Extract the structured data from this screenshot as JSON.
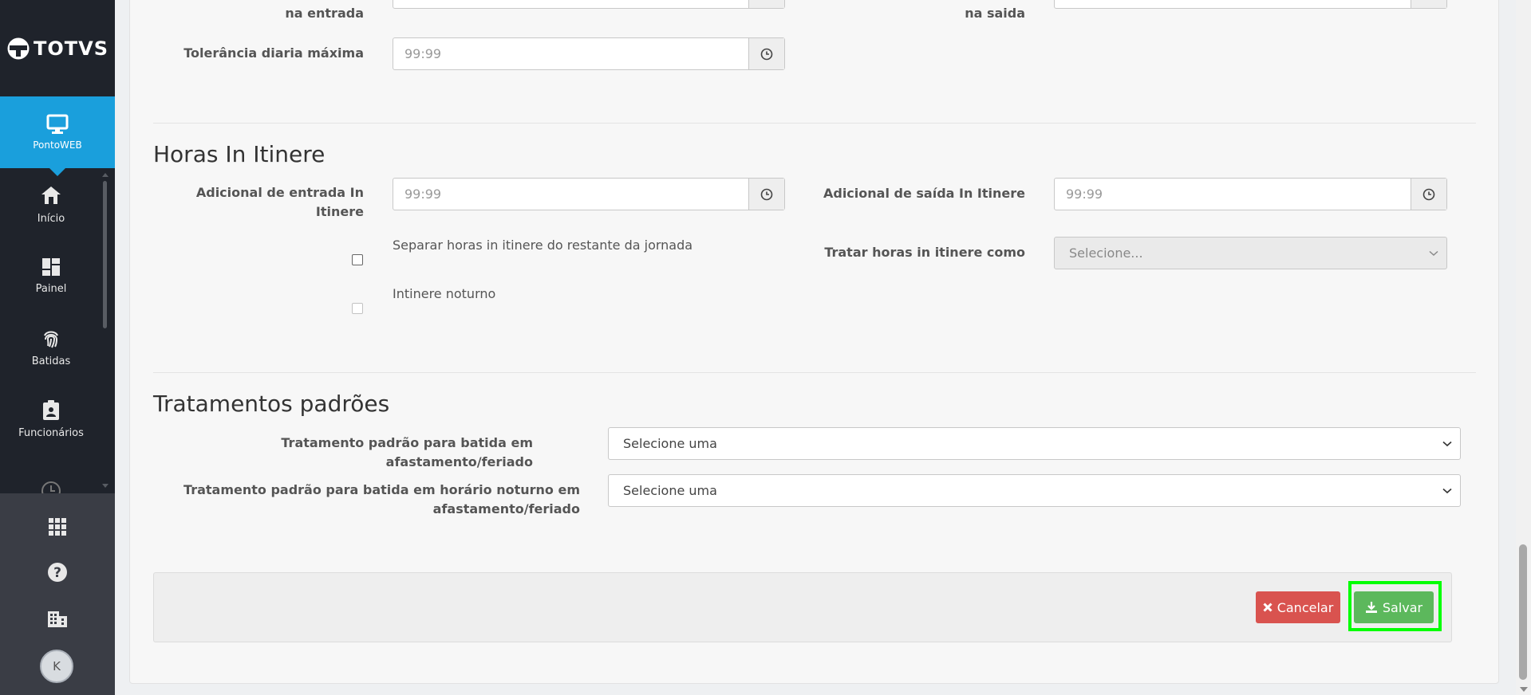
{
  "brand": {
    "name": "TOTVS"
  },
  "sidebar": {
    "active": {
      "label": "PontoWEB",
      "icon": "monitor-icon"
    },
    "items": [
      {
        "label": "Início",
        "icon": "home-icon"
      },
      {
        "label": "Painel",
        "icon": "dashboard-icon"
      },
      {
        "label": "Batidas",
        "icon": "fingerprint-icon"
      },
      {
        "label": "Funcionários",
        "icon": "badge-icon"
      }
    ],
    "bottom": [
      {
        "icon": "apps-grid-icon"
      },
      {
        "icon": "help-icon"
      },
      {
        "icon": "building-icon"
      }
    ],
    "avatar_initial": "K"
  },
  "top_section": {
    "label_left_partial": "na entrada",
    "label_right_partial": "na saida",
    "tolerancia_label": "Tolerância diaria máxima",
    "tolerancia_placeholder": "99:99"
  },
  "itinere": {
    "title": "Horas In Itinere",
    "entrada_label_line1": "Adicional de entrada In",
    "entrada_label_line2": "Itinere",
    "entrada_placeholder": "99:99",
    "saida_label": "Adicional de saída In Itinere",
    "saida_placeholder": "99:99",
    "separar_label": "Separar horas in itinere do restante da jornada",
    "separar_checked": false,
    "noturno_label": "Intinere noturno",
    "noturno_checked": false,
    "tratar_label": "Tratar horas in itinere como",
    "tratar_value": "Selecione..."
  },
  "tratamentos": {
    "title": "Tratamentos padrões",
    "afastamento_label": "Tratamento padrão para batida em afastamento/feriado",
    "afastamento_value": "Selecione uma",
    "noturno_label_line1": "Tratamento padrão para batida em horário noturno em",
    "noturno_label_line2": "afastamento/feriado",
    "noturno_value": "Selecione uma"
  },
  "actions": {
    "cancel_label": "Cancelar",
    "save_label": "Salvar"
  },
  "colors": {
    "sidebar_bg": "#1f232b",
    "active_nav": "#1a9fdc",
    "cancel": "#d9534f",
    "save": "#5cb85c",
    "highlight": "#00ff00"
  }
}
